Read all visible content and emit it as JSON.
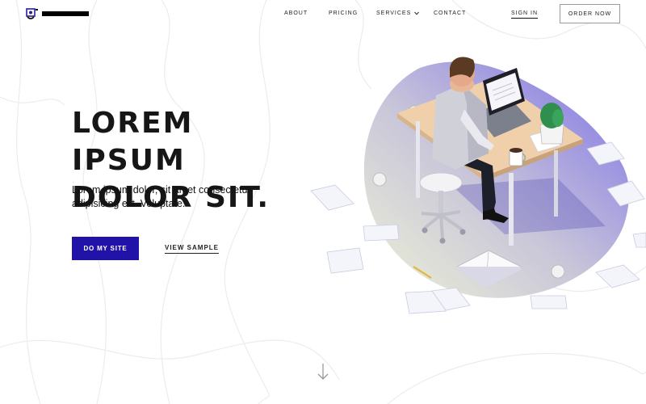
{
  "nav": {
    "about": "ABOUT",
    "pricing": "PRICING",
    "services": "SERVICES",
    "contact": "CONTACT",
    "sign_in": "SIGN IN",
    "order_now": "ORDER NOW"
  },
  "hero": {
    "title_line1": "LOREM IPSUM",
    "title_line2": "DOLOR SIT.",
    "subtitle": "Lorem ipsum dolor, sit amet consectetur adipisicing elit. Voluptate.",
    "primary_button": "DO MY SITE",
    "secondary_link": "VIEW SAMPLE"
  },
  "icons": {
    "logo": "logo-mark-icon",
    "services_dropdown": "chevron-down-icon",
    "scroll": "arrow-down-icon"
  },
  "colors": {
    "primary_button": "#2213a8",
    "blob_start": "#e8edcf",
    "blob_end": "#7b6fe6",
    "text": "#161616"
  }
}
